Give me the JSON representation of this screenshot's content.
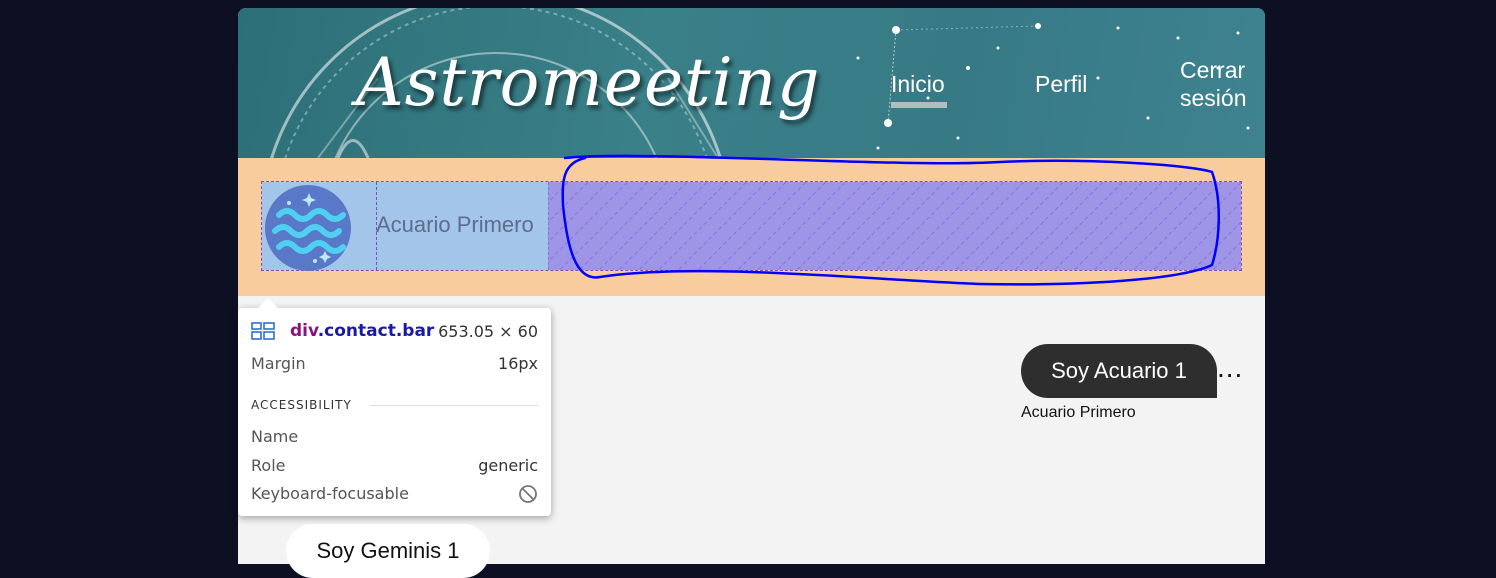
{
  "app": {
    "logo": "Astromeeting",
    "nav": {
      "inicio": "Inicio",
      "perfil": "Perfil",
      "cerrar": "Cerrar sesión"
    }
  },
  "contact": {
    "name": "Acuario Primero",
    "avatar_icon": "aquarius-icon"
  },
  "inspector": {
    "tag": "div",
    "class": ".contact.bar",
    "size": "653.05 × 60",
    "margin_label": "Margin",
    "margin_value": "16px",
    "section": "ACCESSIBILITY",
    "name_label": "Name",
    "role_label": "Role",
    "role_value": "generic",
    "focus_label": "Keyboard-focusable",
    "focus_icon": "not-allowed-icon"
  },
  "messages": [
    {
      "text": "Soy Acuario 1",
      "sender": "Acuario Primero",
      "more": "..."
    },
    {
      "text": "Soy Geminis 1"
    }
  ],
  "colors": {
    "page_bg": "#0c1022",
    "header_bg": "#377a86",
    "contact_area_bg": "#f8cc9c",
    "bubble_me": "#2e2e2e",
    "annotation_stroke": "#0000ff"
  }
}
